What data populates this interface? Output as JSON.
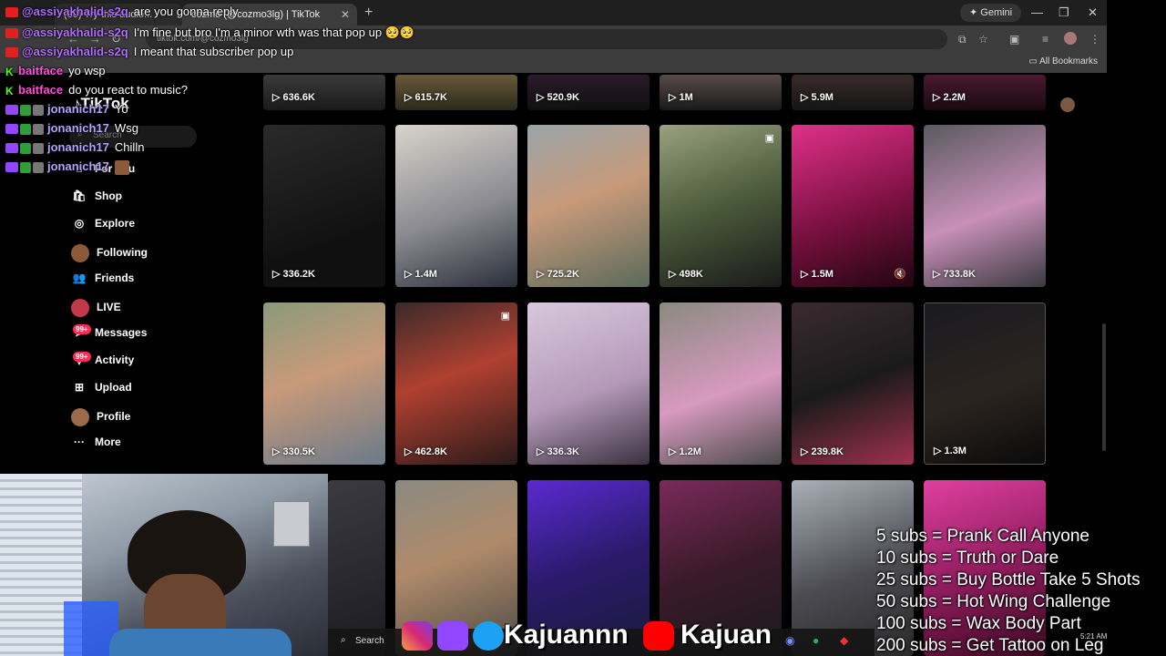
{
  "browser": {
    "tabs": [
      {
        "title": "(30) Try this audio..."
      },
      {
        "title": "cozmo (@cozmo3lg) | TikTok"
      }
    ],
    "url": "tiktok.com/@cozmo3lg",
    "gemini_label": "Gemini",
    "bookmarks_label": "All Bookmarks"
  },
  "tiktok": {
    "logo": "TikTok",
    "search_placeholder": "Search",
    "nav": [
      {
        "label": "For You",
        "icon": "home-icon"
      },
      {
        "label": "Shop",
        "icon": "shop-icon"
      },
      {
        "label": "Explore",
        "icon": "compass-icon"
      },
      {
        "label": "Following",
        "icon": "following-avatar-icon"
      },
      {
        "label": "Friends",
        "icon": "friends-icon"
      },
      {
        "label": "LIVE",
        "icon": "live-icon"
      },
      {
        "label": "Messages",
        "icon": "messages-icon",
        "badge": "99+"
      },
      {
        "label": "Activity",
        "icon": "activity-icon",
        "badge": "99+"
      },
      {
        "label": "Upload",
        "icon": "upload-icon"
      },
      {
        "label": "Profile",
        "icon": "profile-avatar-icon"
      },
      {
        "label": "More",
        "icon": "more-icon"
      }
    ],
    "rows": [
      {
        "views": [
          "636.6K",
          "615.7K",
          "520.9K",
          "1M",
          "5.9M",
          "2.2M"
        ]
      },
      {
        "views": [
          "336.2K",
          "1.4M",
          "725.2K",
          "498K",
          "1.5M",
          "733.8K"
        ]
      },
      {
        "views": [
          "330.5K",
          "462.8K",
          "336.3K",
          "1.2M",
          "239.8K",
          "1.3M"
        ]
      },
      {
        "views": [
          "",
          "",
          "",
          "",
          "",
          ""
        ]
      }
    ]
  },
  "chat": [
    {
      "platform": "yt",
      "user": "@assiyakhalid-s2q",
      "color": "#b36cff",
      "msg": "are you gonna reply"
    },
    {
      "platform": "yt",
      "user": "@assiyakhalid-s2q",
      "color": "#b36cff",
      "msg": "I'm fine but bro I'm a minor wth was that pop up"
    },
    {
      "platform": "yt",
      "user": "@assiyakhalid-s2q",
      "color": "#b36cff",
      "msg": "I meant that subscriber pop up"
    },
    {
      "platform": "kick",
      "user": "baitface",
      "color": "#ff4fd8",
      "msg": "yo wsp"
    },
    {
      "platform": "kick",
      "user": "baitface",
      "color": "#ff4fd8",
      "msg": "do you react to music?"
    },
    {
      "platform": "tw",
      "user": "jonanich17",
      "color": "#b5a2ff",
      "msg": "Yo"
    },
    {
      "platform": "tw",
      "user": "jonanich17",
      "color": "#b5a2ff",
      "msg": "Wsg"
    },
    {
      "platform": "tw",
      "user": "jonanich17",
      "color": "#b5a2ff",
      "msg": "Chilln"
    },
    {
      "platform": "tw",
      "user": "jonanich17",
      "color": "#b5a2ff",
      "msg": ""
    }
  ],
  "subs_goals": [
    "5 subs =  Prank Call Anyone",
    "10 subs = Truth or Dare",
    "25 subs = Buy Bottle Take 5 Shots",
    "50 subs = Hot Wing Challenge",
    "100 subs = Wax Body Part",
    "200 subs = Get Tattoo on Leg"
  ],
  "socials": {
    "handle1": "Kajuannn",
    "handle2": "Kajuan"
  },
  "taskbar": {
    "search_label": "Search",
    "time": "5:21 AM"
  },
  "colors": {
    "accent": "#fe2c55",
    "twitch": "#9146ff",
    "kick": "#53fc18",
    "youtube": "#ff0000"
  }
}
